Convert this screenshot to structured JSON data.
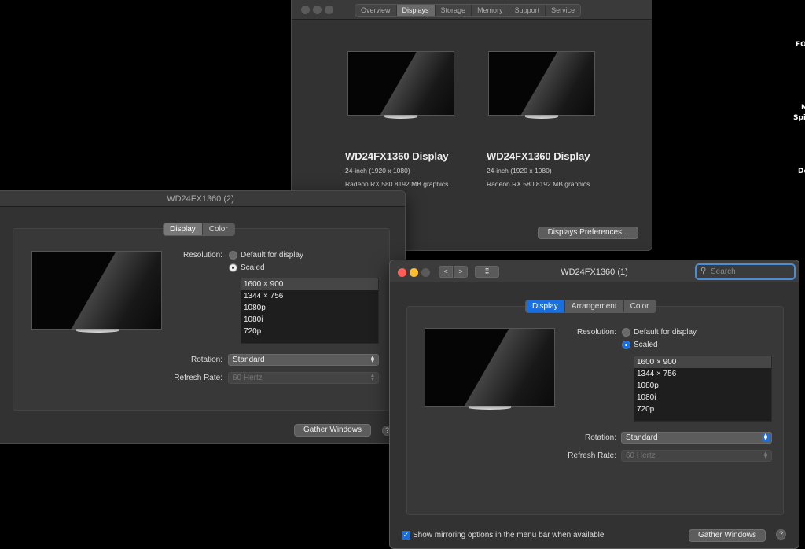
{
  "desktop": {
    "labels": [
      "FO",
      "M",
      "Spi",
      "De"
    ]
  },
  "about_window": {
    "tabs": [
      "Overview",
      "Displays",
      "Storage",
      "Memory",
      "Support",
      "Service"
    ],
    "active_tab": "Displays",
    "displays": [
      {
        "name": "WD24FX1360 Display",
        "size": "24-inch (1920 x 1080)",
        "graphics": "Radeon RX 580 8192 MB graphics"
      },
      {
        "name": "WD24FX1360 Display",
        "size": "24-inch (1920 x 1080)",
        "graphics": "Radeon RX 580 8192 MB graphics"
      }
    ],
    "prefs_button": "Displays Preferences..."
  },
  "display2_window": {
    "title": "WD24FX1360 (2)",
    "tabs": [
      "Display",
      "Color"
    ],
    "active_tab": "Display",
    "resolution_label": "Resolution:",
    "option_default": "Default for display",
    "option_scaled": "Scaled",
    "resolutions": [
      "1600 × 900",
      "1344 × 756",
      "1080p",
      "1080i",
      "720p"
    ],
    "selected_resolution": "1600 × 900",
    "rotation_label": "Rotation:",
    "rotation_value": "Standard",
    "refresh_label": "Refresh Rate:",
    "refresh_value": "60 Hertz",
    "gather_button": "Gather Windows",
    "help": "?"
  },
  "display1_window": {
    "title": "WD24FX1360 (1)",
    "nav_back": "<",
    "nav_forward": ">",
    "grid_icon": "⠿",
    "search_placeholder": "Search",
    "tabs": [
      "Display",
      "Arrangement",
      "Color"
    ],
    "active_tab": "Display",
    "resolution_label": "Resolution:",
    "option_default": "Default for display",
    "option_scaled": "Scaled",
    "resolutions": [
      "1600 × 900",
      "1344 × 756",
      "1080p",
      "1080i",
      "720p"
    ],
    "selected_resolution": "1600 × 900",
    "rotation_label": "Rotation:",
    "rotation_value": "Standard",
    "refresh_label": "Refresh Rate:",
    "refresh_value": "60 Hertz",
    "mirroring_label": "Show mirroring options in the menu bar when available",
    "mirroring_checked": true,
    "gather_button": "Gather Windows",
    "help": "?"
  },
  "colors": {
    "accent_blue": "#1a6fe0",
    "close": "#ff5f57",
    "minimize": "#febc2e",
    "inactive_dot": "#5a5a5a"
  }
}
